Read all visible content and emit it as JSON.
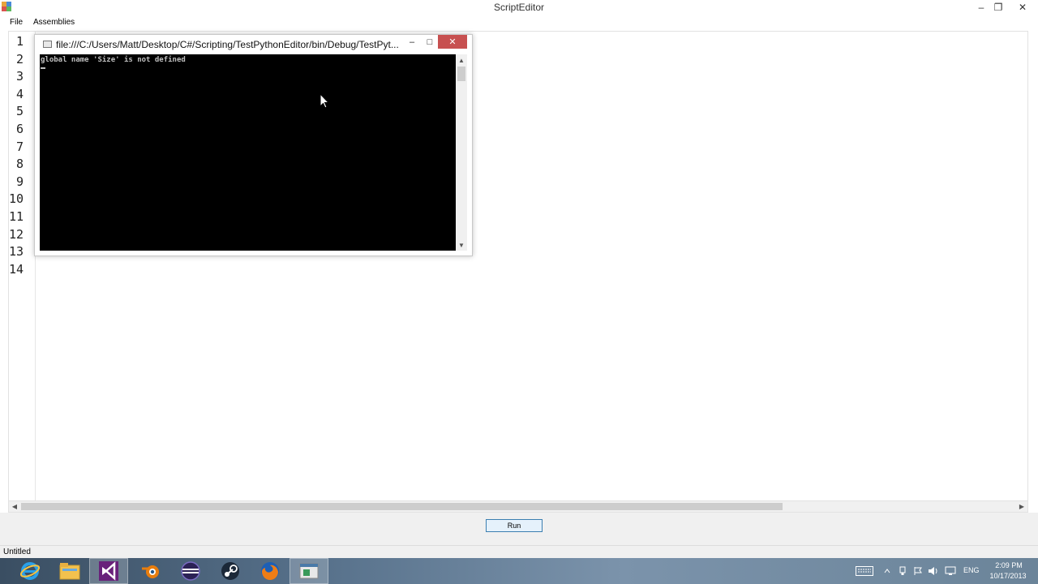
{
  "window": {
    "title": "ScriptEditor",
    "minimize_glyph": "–",
    "restore_glyph": "❐",
    "close_glyph": "✕"
  },
  "menu": {
    "file": "File",
    "assemblies": "Assemblies"
  },
  "editor": {
    "line_numbers": [
      "1",
      "2",
      "3",
      "4",
      "5",
      "6",
      "7",
      "8",
      "9",
      "10",
      "11",
      "12",
      "13",
      "14"
    ]
  },
  "console": {
    "title": "file:///C:/Users/Matt/Desktop/C#/Scripting/TestPythonEditor/bin/Debug/TestPyt...",
    "output": "global name 'Size' is not defined",
    "minimize_glyph": "–",
    "maximize_glyph": "□",
    "close_glyph": "✕"
  },
  "scroll": {
    "left_glyph": "◀",
    "right_glyph": "▶",
    "up_glyph": "▲",
    "down_glyph": "▼"
  },
  "run_button": {
    "label": "Run"
  },
  "status": {
    "text": "Untitled"
  },
  "taskbar": {
    "apps": [
      {
        "name": "internet-explorer-icon"
      },
      {
        "name": "file-explorer-icon"
      },
      {
        "name": "visual-studio-icon"
      },
      {
        "name": "blender-icon"
      },
      {
        "name": "eclipse-icon"
      },
      {
        "name": "steam-icon"
      },
      {
        "name": "firefox-icon"
      },
      {
        "name": "script-editor-icon"
      }
    ],
    "tray": {
      "language": "ENG",
      "time": "2:09 PM",
      "date": "10/17/2013"
    }
  },
  "colors": {
    "console_close": "#c75050",
    "run_border": "#3c7fb1",
    "console_bg": "#000000"
  }
}
